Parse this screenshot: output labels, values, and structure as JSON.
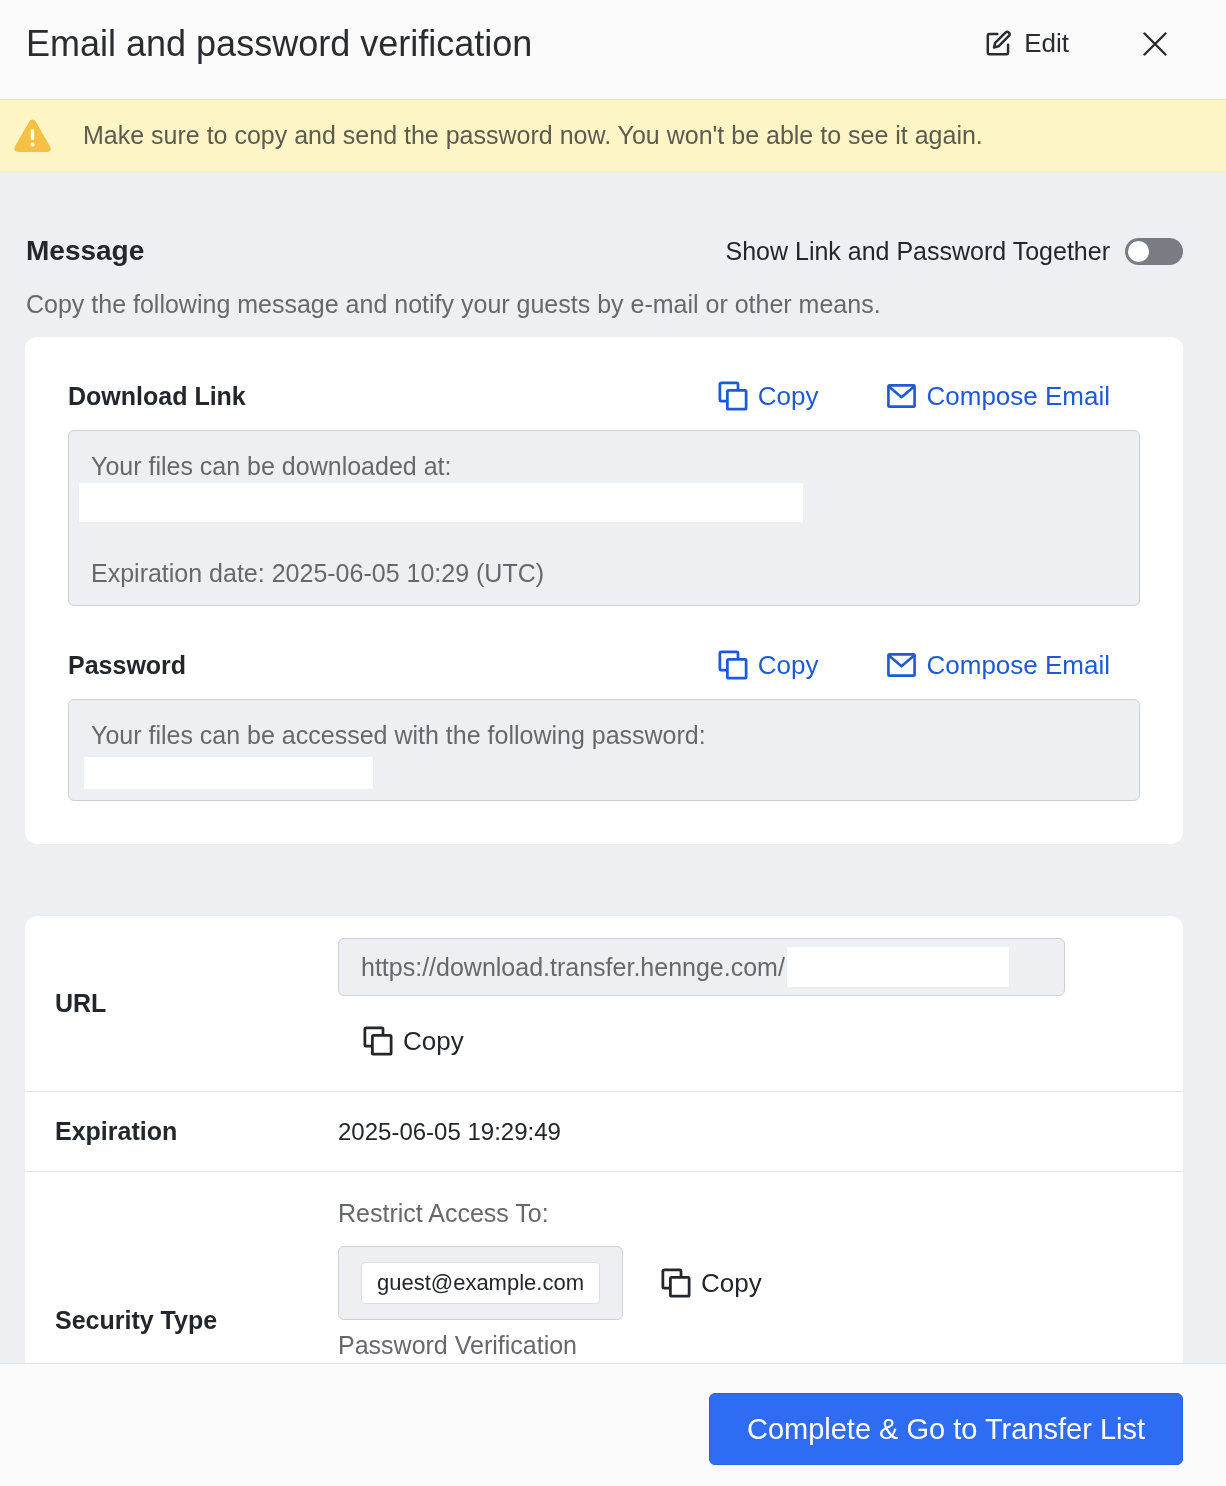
{
  "header": {
    "title": "Email and password verification",
    "edit_label": "Edit"
  },
  "warning": {
    "text": "Make sure to copy and send the password now. You won't be able to see it again."
  },
  "message": {
    "heading": "Message",
    "toggle": {
      "label": "Show Link and Password Together",
      "on": false
    },
    "description": "Copy the following message and notify your guests by e-mail or other means.",
    "blocks": [
      {
        "kind": "link",
        "heading": "Download Link",
        "actions": [
          {
            "kind": "copy",
            "label": "Copy"
          },
          {
            "kind": "email",
            "label": "Compose Email"
          }
        ],
        "lines": [
          {
            "kind": "text",
            "text": "Your files can be downloaded at:"
          },
          {
            "kind": "redacted"
          },
          {
            "kind": "text",
            "text": "Expiration date: 2025-06-05 10:29 (UTC)"
          }
        ]
      },
      {
        "kind": "password",
        "heading": "Password",
        "actions": [
          {
            "kind": "copy",
            "label": "Copy"
          },
          {
            "kind": "email",
            "label": "Compose Email"
          }
        ],
        "lines": [
          {
            "kind": "text",
            "text": "Your files can be accessed with the following password:"
          },
          {
            "kind": "redacted"
          }
        ]
      }
    ]
  },
  "details": {
    "rows": [
      {
        "kind": "url",
        "label": "URL",
        "value": "https://download.transfer.hennge.com/",
        "redacted": true,
        "copy_label": "Copy"
      },
      {
        "kind": "text",
        "label": "Expiration",
        "value": "2025-06-05 19:29:49"
      },
      {
        "kind": "security",
        "label": "Security Type",
        "caption": "Restrict Access To:",
        "email": "guest@example.com",
        "copy_label": "Copy",
        "method": "Password Verification"
      }
    ]
  },
  "footer": {
    "button": "Complete & Go to Transfer List"
  }
}
